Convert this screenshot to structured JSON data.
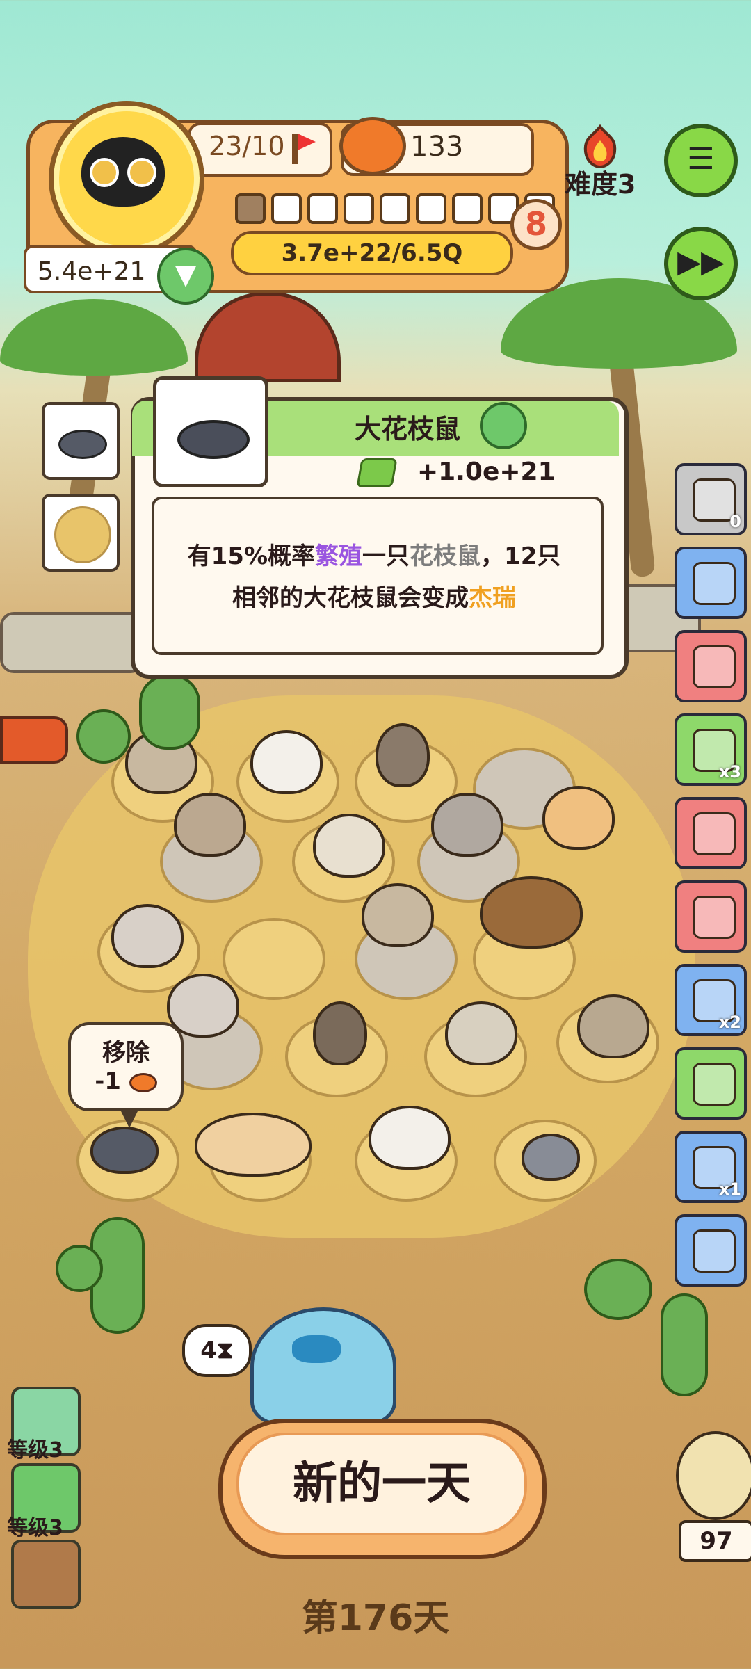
{
  "hud": {
    "level_progress": "23/10",
    "food_count": "133",
    "pips_filled": 1,
    "pips_total": 9,
    "stage_number": "8",
    "coin_progress": "3.7e+22/6.5Q",
    "money": "5.4e+21",
    "difficulty": "难度3"
  },
  "popup": {
    "title": "大花枝鼠",
    "reward": "+1.0e+21",
    "desc_part1": "有15%概率",
    "desc_highlight1": "繁殖",
    "desc_part2": "一只",
    "desc_highlight2": "花枝鼠",
    "desc_part3": "，12只",
    "desc_part4": "相邻的大花枝鼠会变成",
    "desc_highlight3": "杰瑞"
  },
  "sidebar": {
    "items": [
      {
        "icon": "film-reel-icon",
        "badge": "0",
        "color": "#c8c8c8"
      },
      {
        "icon": "trophy-icon",
        "badge": "",
        "color": "#7fb2f0"
      },
      {
        "icon": "whistle-icon",
        "badge": "",
        "color": "#f08080"
      },
      {
        "icon": "tent-icon",
        "badge": "x3",
        "color": "#8ed86a"
      },
      {
        "icon": "heart-pet-icon",
        "badge": "",
        "color": "#f08080"
      },
      {
        "icon": "bamboo-icon",
        "badge": "",
        "color": "#f08080"
      },
      {
        "icon": "clover-charm-icon",
        "badge": "x2",
        "color": "#7fb2f0"
      },
      {
        "icon": "ticket-icon",
        "badge": "",
        "color": "#8ed86a"
      },
      {
        "icon": "jar-icon",
        "badge": "x1",
        "color": "#7fb2f0"
      },
      {
        "icon": "cart-icon",
        "badge": "",
        "color": "#7fb2f0"
      }
    ]
  },
  "remove": {
    "label": "移除",
    "cost": "-1"
  },
  "timer": {
    "value": "4"
  },
  "new_day_button": "新的一天",
  "day_label": "第176天",
  "levels": [
    {
      "label": "等级3"
    },
    {
      "label": "等级3"
    }
  ],
  "counter": "97",
  "colors": {
    "panel_orange": "#f7b45f",
    "popup_green": "#a9e07a",
    "accent_purple": "#9a55e0",
    "accent_gold": "#f0a020"
  }
}
